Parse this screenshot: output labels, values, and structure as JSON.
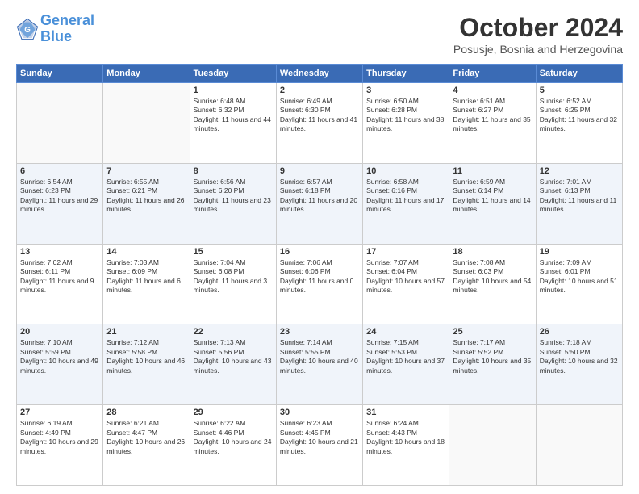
{
  "header": {
    "logo_line1": "General",
    "logo_line2": "Blue",
    "month": "October 2024",
    "location": "Posusje, Bosnia and Herzegovina"
  },
  "weekdays": [
    "Sunday",
    "Monday",
    "Tuesday",
    "Wednesday",
    "Thursday",
    "Friday",
    "Saturday"
  ],
  "rows": [
    [
      {
        "day": "",
        "info": ""
      },
      {
        "day": "",
        "info": ""
      },
      {
        "day": "1",
        "info": "Sunrise: 6:48 AM\nSunset: 6:32 PM\nDaylight: 11 hours and 44 minutes."
      },
      {
        "day": "2",
        "info": "Sunrise: 6:49 AM\nSunset: 6:30 PM\nDaylight: 11 hours and 41 minutes."
      },
      {
        "day": "3",
        "info": "Sunrise: 6:50 AM\nSunset: 6:28 PM\nDaylight: 11 hours and 38 minutes."
      },
      {
        "day": "4",
        "info": "Sunrise: 6:51 AM\nSunset: 6:27 PM\nDaylight: 11 hours and 35 minutes."
      },
      {
        "day": "5",
        "info": "Sunrise: 6:52 AM\nSunset: 6:25 PM\nDaylight: 11 hours and 32 minutes."
      }
    ],
    [
      {
        "day": "6",
        "info": "Sunrise: 6:54 AM\nSunset: 6:23 PM\nDaylight: 11 hours and 29 minutes."
      },
      {
        "day": "7",
        "info": "Sunrise: 6:55 AM\nSunset: 6:21 PM\nDaylight: 11 hours and 26 minutes."
      },
      {
        "day": "8",
        "info": "Sunrise: 6:56 AM\nSunset: 6:20 PM\nDaylight: 11 hours and 23 minutes."
      },
      {
        "day": "9",
        "info": "Sunrise: 6:57 AM\nSunset: 6:18 PM\nDaylight: 11 hours and 20 minutes."
      },
      {
        "day": "10",
        "info": "Sunrise: 6:58 AM\nSunset: 6:16 PM\nDaylight: 11 hours and 17 minutes."
      },
      {
        "day": "11",
        "info": "Sunrise: 6:59 AM\nSunset: 6:14 PM\nDaylight: 11 hours and 14 minutes."
      },
      {
        "day": "12",
        "info": "Sunrise: 7:01 AM\nSunset: 6:13 PM\nDaylight: 11 hours and 11 minutes."
      }
    ],
    [
      {
        "day": "13",
        "info": "Sunrise: 7:02 AM\nSunset: 6:11 PM\nDaylight: 11 hours and 9 minutes."
      },
      {
        "day": "14",
        "info": "Sunrise: 7:03 AM\nSunset: 6:09 PM\nDaylight: 11 hours and 6 minutes."
      },
      {
        "day": "15",
        "info": "Sunrise: 7:04 AM\nSunset: 6:08 PM\nDaylight: 11 hours and 3 minutes."
      },
      {
        "day": "16",
        "info": "Sunrise: 7:06 AM\nSunset: 6:06 PM\nDaylight: 11 hours and 0 minutes."
      },
      {
        "day": "17",
        "info": "Sunrise: 7:07 AM\nSunset: 6:04 PM\nDaylight: 10 hours and 57 minutes."
      },
      {
        "day": "18",
        "info": "Sunrise: 7:08 AM\nSunset: 6:03 PM\nDaylight: 10 hours and 54 minutes."
      },
      {
        "day": "19",
        "info": "Sunrise: 7:09 AM\nSunset: 6:01 PM\nDaylight: 10 hours and 51 minutes."
      }
    ],
    [
      {
        "day": "20",
        "info": "Sunrise: 7:10 AM\nSunset: 5:59 PM\nDaylight: 10 hours and 49 minutes."
      },
      {
        "day": "21",
        "info": "Sunrise: 7:12 AM\nSunset: 5:58 PM\nDaylight: 10 hours and 46 minutes."
      },
      {
        "day": "22",
        "info": "Sunrise: 7:13 AM\nSunset: 5:56 PM\nDaylight: 10 hours and 43 minutes."
      },
      {
        "day": "23",
        "info": "Sunrise: 7:14 AM\nSunset: 5:55 PM\nDaylight: 10 hours and 40 minutes."
      },
      {
        "day": "24",
        "info": "Sunrise: 7:15 AM\nSunset: 5:53 PM\nDaylight: 10 hours and 37 minutes."
      },
      {
        "day": "25",
        "info": "Sunrise: 7:17 AM\nSunset: 5:52 PM\nDaylight: 10 hours and 35 minutes."
      },
      {
        "day": "26",
        "info": "Sunrise: 7:18 AM\nSunset: 5:50 PM\nDaylight: 10 hours and 32 minutes."
      }
    ],
    [
      {
        "day": "27",
        "info": "Sunrise: 6:19 AM\nSunset: 4:49 PM\nDaylight: 10 hours and 29 minutes."
      },
      {
        "day": "28",
        "info": "Sunrise: 6:21 AM\nSunset: 4:47 PM\nDaylight: 10 hours and 26 minutes."
      },
      {
        "day": "29",
        "info": "Sunrise: 6:22 AM\nSunset: 4:46 PM\nDaylight: 10 hours and 24 minutes."
      },
      {
        "day": "30",
        "info": "Sunrise: 6:23 AM\nSunset: 4:45 PM\nDaylight: 10 hours and 21 minutes."
      },
      {
        "day": "31",
        "info": "Sunrise: 6:24 AM\nSunset: 4:43 PM\nDaylight: 10 hours and 18 minutes."
      },
      {
        "day": "",
        "info": ""
      },
      {
        "day": "",
        "info": ""
      }
    ]
  ]
}
